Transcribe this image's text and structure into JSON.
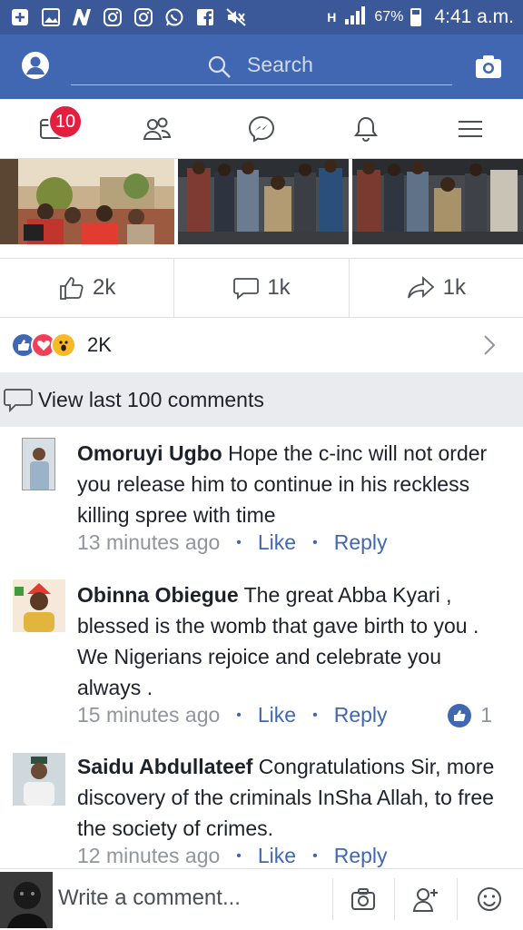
{
  "status_bar": {
    "battery": "67%",
    "time": "4:41 a.m.",
    "network": "H"
  },
  "search": {
    "placeholder": "Search"
  },
  "nav": {
    "notification_count": "10"
  },
  "actions": {
    "likes": "2k",
    "comments": "1k",
    "shares": "1k"
  },
  "reactions": {
    "count": "2K"
  },
  "view_last_label": "View last 100 comments",
  "comments": [
    {
      "name": "Omoruyi Ugbo",
      "text": "Hope the c-inc will not order you release him to continue in his reckless killing spree with time",
      "time": "13 minutes ago",
      "like": "Like",
      "reply": "Reply",
      "like_count": ""
    },
    {
      "name": "Obinna Obiegue",
      "text": "The great Abba Kyari , blessed is the womb that gave birth to you . We Nigerians rejoice and celebrate you always .",
      "time": "15 minutes ago",
      "like": "Like",
      "reply": "Reply",
      "like_count": "1"
    },
    {
      "name": "Saidu Abdullateef",
      "text": "Congratulations Sir, more discovery of the criminals InSha Allah, to free the society of crimes.",
      "time": "12 minutes ago",
      "like": "Like",
      "reply": "Reply",
      "like_count": ""
    }
  ],
  "composer": {
    "placeholder": "Write a comment..."
  }
}
